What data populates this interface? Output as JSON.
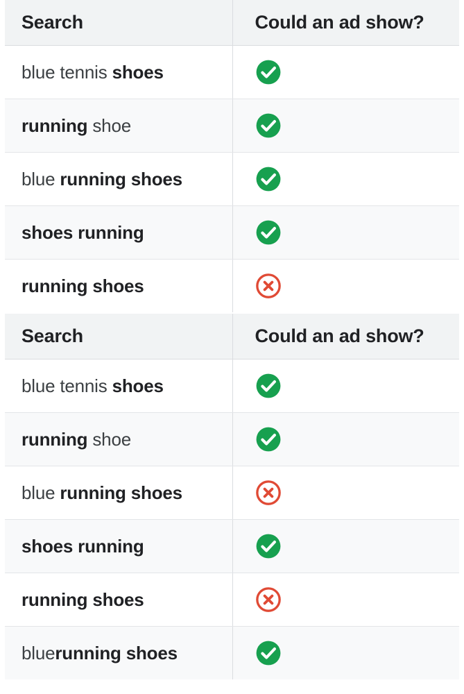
{
  "colors": {
    "header_bg": "#f1f3f4",
    "alt_row_bg": "#f8f9fa",
    "border": "#dadce0",
    "text": "#202124",
    "check_green": "#17a04f",
    "cross_red": "#e04a35"
  },
  "icons": {
    "allowed": "check-circle-icon",
    "blocked": "x-circle-icon"
  },
  "tables": [
    {
      "id": "table-1",
      "columns": {
        "search": "Search",
        "ad_show": "Could an ad show?"
      },
      "rows": [
        {
          "search_full": "blue tennis shoes",
          "parts": [
            {
              "text": "blue tennis ",
              "bold": false
            },
            {
              "text": "shoes",
              "bold": true
            }
          ],
          "ad_show": "yes",
          "ad_show_icon": "check-circle-icon"
        },
        {
          "search_full": "running shoe",
          "parts": [
            {
              "text": "running",
              "bold": true
            },
            {
              "text": " shoe",
              "bold": false
            }
          ],
          "ad_show": "yes",
          "ad_show_icon": "check-circle-icon"
        },
        {
          "search_full": "blue running shoes",
          "parts": [
            {
              "text": "blue ",
              "bold": false
            },
            {
              "text": "running shoes",
              "bold": true
            }
          ],
          "ad_show": "yes",
          "ad_show_icon": "check-circle-icon"
        },
        {
          "search_full": "shoes running",
          "parts": [
            {
              "text": "shoes running",
              "bold": true
            }
          ],
          "ad_show": "yes",
          "ad_show_icon": "check-circle-icon"
        },
        {
          "search_full": "running shoes",
          "parts": [
            {
              "text": "running shoes",
              "bold": true
            }
          ],
          "ad_show": "no",
          "ad_show_icon": "x-circle-icon"
        }
      ]
    },
    {
      "id": "table-2",
      "columns": {
        "search": "Search",
        "ad_show": "Could an ad show?"
      },
      "rows": [
        {
          "search_full": "blue tennis shoes",
          "parts": [
            {
              "text": "blue tennis ",
              "bold": false
            },
            {
              "text": "shoes",
              "bold": true
            }
          ],
          "ad_show": "yes",
          "ad_show_icon": "check-circle-icon"
        },
        {
          "search_full": "running shoe",
          "parts": [
            {
              "text": "running",
              "bold": true
            },
            {
              "text": " shoe",
              "bold": false
            }
          ],
          "ad_show": "yes",
          "ad_show_icon": "check-circle-icon"
        },
        {
          "search_full": "blue running shoes",
          "parts": [
            {
              "text": "blue ",
              "bold": false
            },
            {
              "text": "running shoes",
              "bold": true
            }
          ],
          "ad_show": "no",
          "ad_show_icon": "x-circle-icon"
        },
        {
          "search_full": "shoes running",
          "parts": [
            {
              "text": "shoes running",
              "bold": true
            }
          ],
          "ad_show": "yes",
          "ad_show_icon": "check-circle-icon"
        },
        {
          "search_full": "running shoes",
          "parts": [
            {
              "text": "running shoes",
              "bold": true
            }
          ],
          "ad_show": "no",
          "ad_show_icon": "x-circle-icon"
        },
        {
          "search_full": "bluerunning shoes",
          "parts": [
            {
              "text": "blue",
              "bold": false
            },
            {
              "text": "running shoes",
              "bold": true
            }
          ],
          "ad_show": "yes",
          "ad_show_icon": "check-circle-icon"
        }
      ]
    }
  ]
}
